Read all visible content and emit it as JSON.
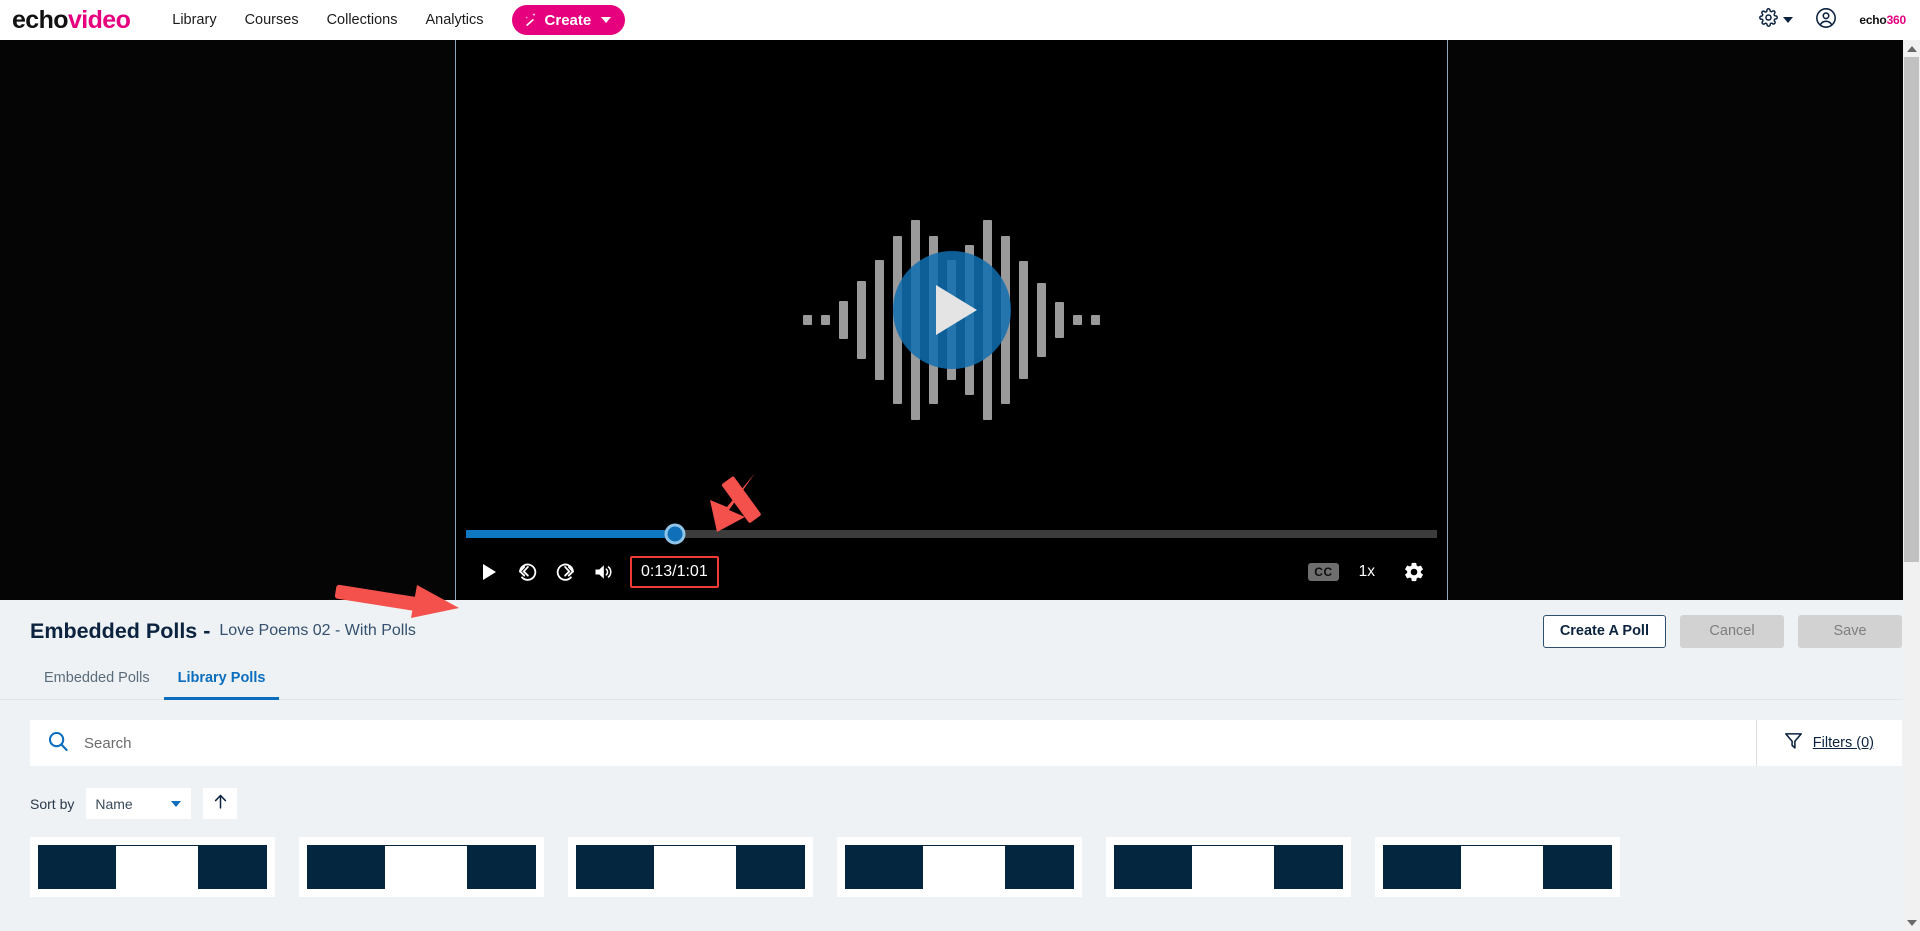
{
  "topnav": {
    "logo_echo": "echo",
    "logo_video": "video",
    "links": [
      {
        "label": "Library"
      },
      {
        "label": "Courses"
      },
      {
        "label": "Collections"
      },
      {
        "label": "Analytics"
      }
    ],
    "create_label": "Create",
    "create_icon": "magic-wand-icon",
    "create_color": "#e6007e",
    "settings_icon": "gear-icon",
    "account_icon": "user-account-icon",
    "brand_mark_1": "echo",
    "brand_mark_2": "360"
  },
  "player": {
    "state": "paused",
    "play_overlay_icon": "play-icon",
    "current_time": "0:13",
    "duration": "1:01",
    "time_display": "0:13/1:01",
    "progress_percent": 21.5,
    "controls": {
      "play_icon": "play-icon",
      "rewind_icon": "rewind-10-icon",
      "forward_icon": "forward-10-icon",
      "volume_icon": "volume-icon",
      "cc_label": "CC",
      "speed_label": "1x",
      "settings_icon": "gear-icon"
    },
    "accent_color": "#0f78c0",
    "annotation_color": "#ef3b36",
    "annotations": [
      {
        "name": "arrow-to-progress-handle"
      },
      {
        "name": "arrow-to-play-button"
      },
      {
        "name": "highlight-box-time-display"
      }
    ]
  },
  "panel": {
    "title": "Embedded Polls -",
    "subtitle": "Love Poems 02 - With Polls",
    "actions": [
      {
        "label": "Create A Poll",
        "style": "outline",
        "enabled": true
      },
      {
        "label": "Cancel",
        "style": "disabled",
        "enabled": false
      },
      {
        "label": "Save",
        "style": "disabled",
        "enabled": false
      }
    ],
    "tabs": [
      {
        "label": "Embedded Polls",
        "active": false
      },
      {
        "label": "Library Polls",
        "active": true
      }
    ],
    "search": {
      "icon": "search-icon",
      "placeholder": "Search",
      "value": ""
    },
    "filters": {
      "icon": "filter-funnel-icon",
      "label": "Filters (0)",
      "count": 0
    },
    "sort": {
      "label": "Sort by",
      "value": "Name",
      "options": [
        "Name"
      ],
      "direction_icon": "arrow-up-icon",
      "direction": "ascending"
    },
    "cards": [
      {
        "name": "poll-card"
      },
      {
        "name": "poll-card"
      },
      {
        "name": "poll-card"
      },
      {
        "name": "poll-card"
      },
      {
        "name": "poll-card"
      },
      {
        "name": "poll-card"
      }
    ],
    "accent_color": "#0b6dbd",
    "card_color": "#04273f"
  },
  "scrollbar": {
    "up_icon": "scroll-up-icon",
    "down_icon": "scroll-down-icon"
  }
}
